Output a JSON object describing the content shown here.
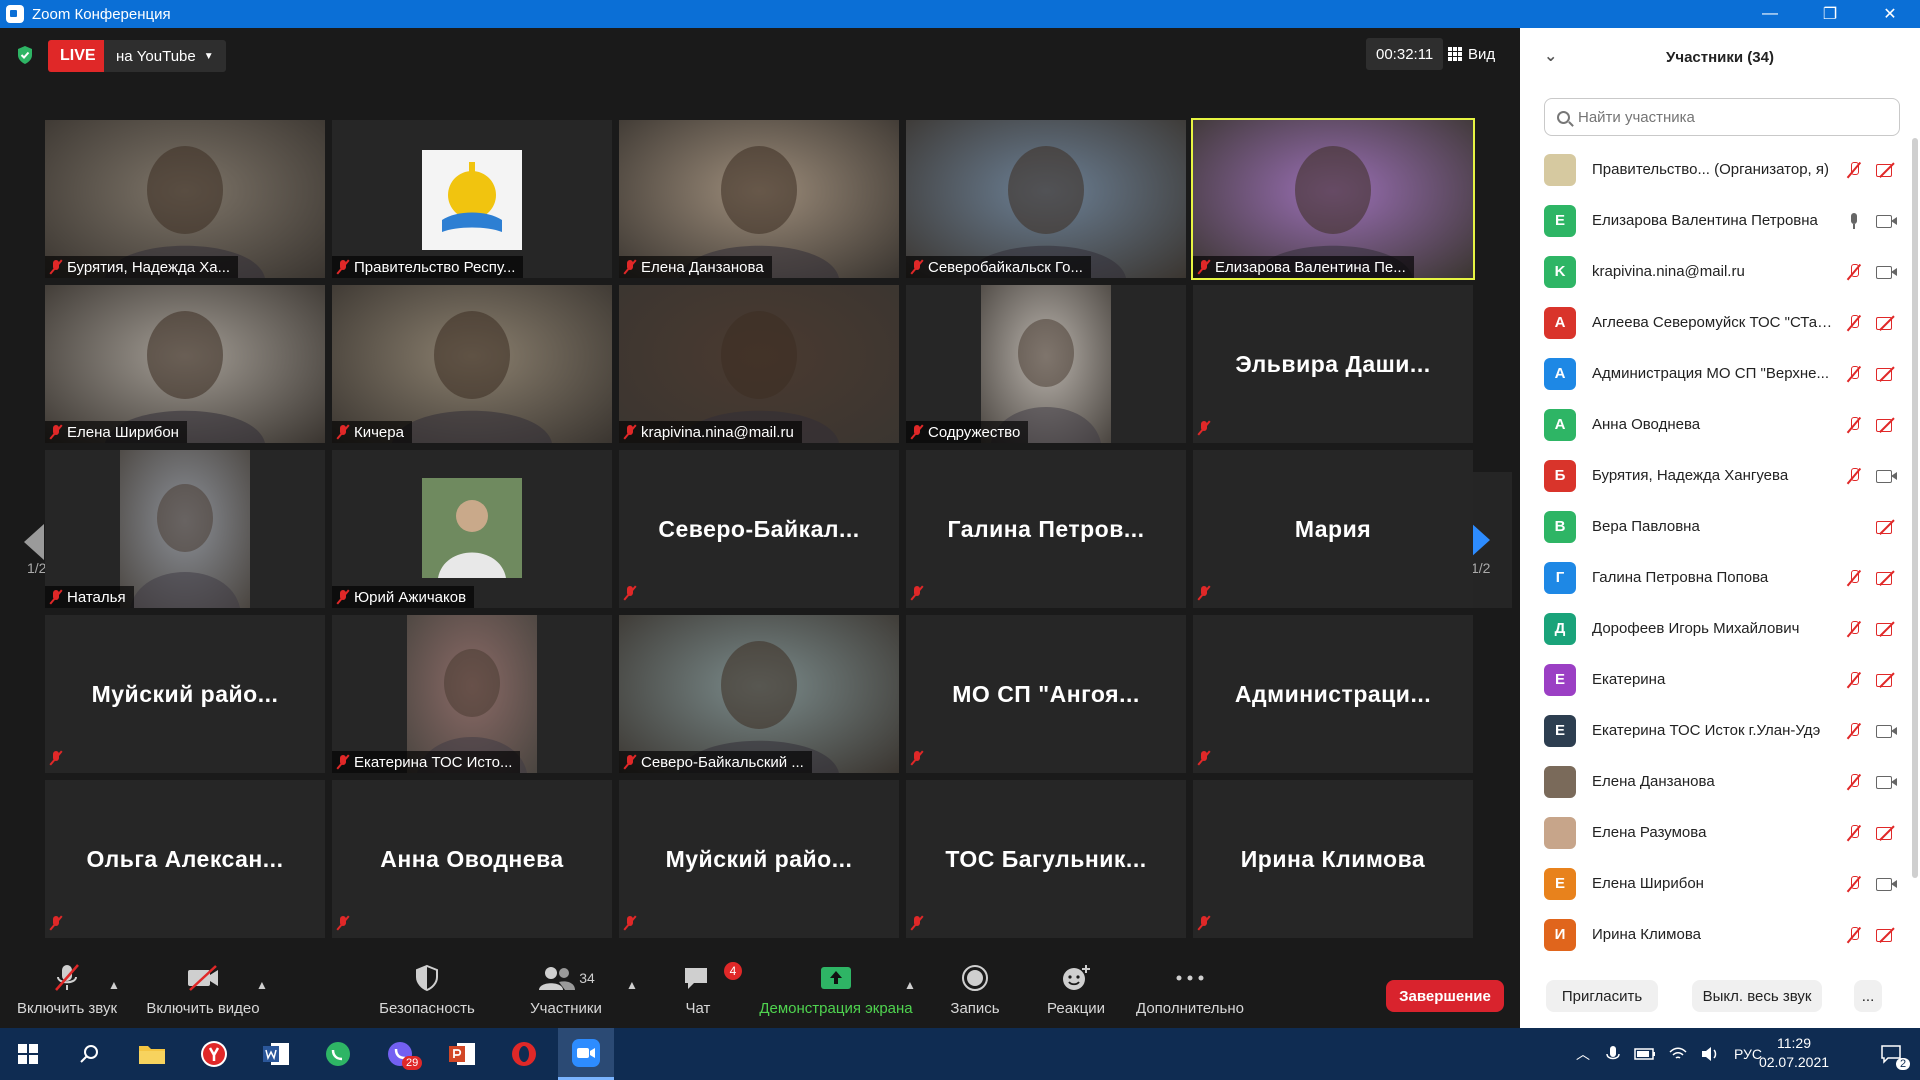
{
  "window": {
    "title": "Zoom Конференция",
    "controls": [
      "—",
      "❐",
      "✕"
    ]
  },
  "meeting": {
    "live_label": "LIVE",
    "stream_target": "на YouTube",
    "timer": "00:32:11",
    "view_label": "Вид",
    "page_indicator": "1/2"
  },
  "tiles": [
    {
      "name": "Бурятия, Надежда Ха...",
      "type": "video",
      "bg": "#7d7468"
    },
    {
      "name": "Правительство Респу...",
      "type": "logo",
      "bg": "#2a2a2a"
    },
    {
      "name": "Елена Данзанова",
      "type": "video",
      "bg": "#9c8c7a"
    },
    {
      "name": "Северобайкальск Го...",
      "type": "video",
      "bg": "#6b7f94"
    },
    {
      "name": "Елизарова Валентина Пе...",
      "type": "video",
      "bg": "#9a6fb5",
      "active": true
    },
    {
      "name": "Елена Ширибон",
      "type": "video",
      "bg": "#a19b93"
    },
    {
      "name": "Кичера",
      "type": "video",
      "bg": "#8a7f6e"
    },
    {
      "name": "krapivina.nina@mail.ru",
      "type": "video",
      "bg": "#4a3a30"
    },
    {
      "name": "Содружество",
      "type": "video-narrow",
      "bg": "#b8b2ab"
    },
    {
      "name": "Эльвира Даши...",
      "type": "name"
    },
    {
      "name": "Наталья",
      "type": "video-narrow",
      "bg": "#8b8f96"
    },
    {
      "name": "Юрий Ажичаков",
      "type": "photo",
      "bg": "#6f8a5f"
    },
    {
      "name": "Северо-Байкал...",
      "type": "name"
    },
    {
      "name": "Галина Петров...",
      "type": "name"
    },
    {
      "name": "Мария",
      "type": "name"
    },
    {
      "name": "Муйский райо...",
      "type": "name"
    },
    {
      "name": "Екатерина ТОС Исто...",
      "type": "video-narrow",
      "bg": "#8a6a66"
    },
    {
      "name": "Северо-Байкальский ...",
      "type": "video",
      "bg": "#7a8a8a"
    },
    {
      "name": "МО СП \"Ангоя...",
      "type": "name"
    },
    {
      "name": "Администраци...",
      "type": "name"
    },
    {
      "name": "Ольга Алексан...",
      "type": "name"
    },
    {
      "name": "Анна Оводнева",
      "type": "name"
    },
    {
      "name": "Муйский райо...",
      "type": "name"
    },
    {
      "name": "ТОС Багульник...",
      "type": "name"
    },
    {
      "name": "Ирина Климова",
      "type": "name"
    }
  ],
  "toolbar": {
    "unmute": "Включить звук",
    "start_video": "Включить видео",
    "security": "Безопасность",
    "participants": "Участники",
    "participants_count": "34",
    "chat": "Чат",
    "chat_badge": "4",
    "share_screen": "Демонстрация экрана",
    "record": "Запись",
    "reactions": "Реакции",
    "more": "Дополнительно",
    "end": "Завершение"
  },
  "panel": {
    "title": "Участники (34)",
    "search_placeholder": "Найти участника",
    "participants": [
      {
        "initial": "",
        "color": "#d6c9a0",
        "name": "Правительство... (Организатор, я)",
        "mic": "off",
        "cam": "off"
      },
      {
        "initial": "Е",
        "color": "#2eb565",
        "name": "Елизарова Валентина Петровна",
        "mic": "on",
        "cam": "on"
      },
      {
        "initial": "K",
        "color": "#2eb565",
        "name": "krapivina.nina@mail.ru",
        "mic": "off",
        "cam": "on"
      },
      {
        "initial": "А",
        "color": "#d9342b",
        "name": "Аглеева Северомуйск ТОС \"СТарт\"",
        "mic": "off",
        "cam": "off"
      },
      {
        "initial": "А",
        "color": "#1e88e5",
        "name": "Администрация МО СП \"Верхне...",
        "mic": "off",
        "cam": "off"
      },
      {
        "initial": "А",
        "color": "#2eb565",
        "name": "Анна Оводнева",
        "mic": "off",
        "cam": "off"
      },
      {
        "initial": "Б",
        "color": "#d9342b",
        "name": "Бурятия, Надежда Хангуева",
        "mic": "off",
        "cam": "on"
      },
      {
        "initial": "В",
        "color": "#2eb565",
        "name": "Вера Павловна",
        "mic": "none",
        "cam": "off"
      },
      {
        "initial": "Г",
        "color": "#1e88e5",
        "name": "Галина Петровна Попова",
        "mic": "off",
        "cam": "off"
      },
      {
        "initial": "Д",
        "color": "#1aa37a",
        "name": "Дорофеев Игорь Михайлович",
        "mic": "off",
        "cam": "off"
      },
      {
        "initial": "Е",
        "color": "#9b3fc4",
        "name": "Екатерина",
        "mic": "off",
        "cam": "off"
      },
      {
        "initial": "Е",
        "color": "#2d3e50",
        "name": "Екатерина ТОС Исток г.Улан-Удэ",
        "mic": "off",
        "cam": "on"
      },
      {
        "initial": "",
        "color": "#7a6a5a",
        "name": "Елена Данзанова",
        "mic": "off",
        "cam": "on"
      },
      {
        "initial": "",
        "color": "#c7a58a",
        "name": "Елена Разумова",
        "mic": "off",
        "cam": "off"
      },
      {
        "initial": "Е",
        "color": "#e8821c",
        "name": "Елена Ширибон",
        "mic": "off",
        "cam": "on"
      },
      {
        "initial": "И",
        "color": "#e0651c",
        "name": "Ирина Климова",
        "mic": "off",
        "cam": "off"
      }
    ],
    "invite": "Пригласить",
    "mute_all": "Выкл. весь звук",
    "more": "..."
  },
  "taskbar": {
    "language": "РУС",
    "time": "11:29",
    "date": "02.07.2021",
    "viber_badge": "29",
    "notif_badge": "2"
  }
}
